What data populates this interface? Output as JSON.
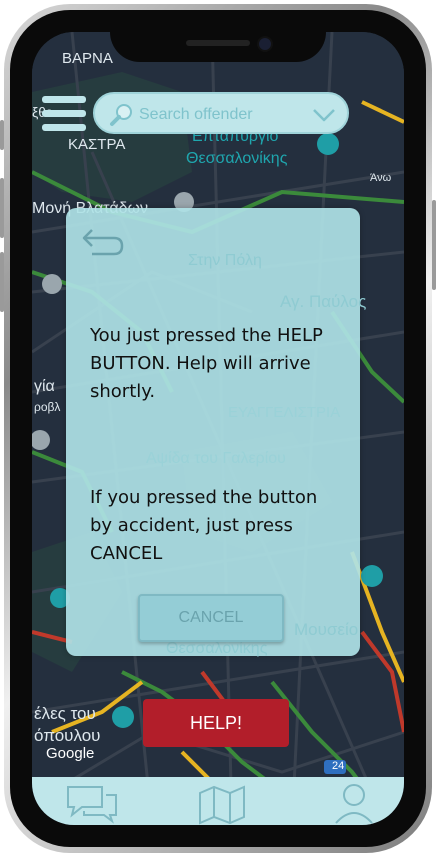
{
  "search": {
    "placeholder": "Search offender"
  },
  "map": {
    "labels": {
      "varna": "ΒΑΡΝΑ",
      "kastra": "ΚΑΣΤΡΑ",
      "eptapyrgio": "Επταπύργιο",
      "thessalonikis": "Θεσσαλονίκης",
      "ano_poli": "Άνω",
      "moni_vlatadon": "Μονή Βλατάδων",
      "stin_poli": "Στην Πόλη",
      "ag_pavlos": "Αγ. Παύλος",
      "gia": "γία",
      "rovli": "ροβλ",
      "evangelistria": "ΕΥΑΓΓΕΛΙΣΤΡΙΑ",
      "apsida": "Αψίδα του Γαλερίου",
      "mouseio": "Μουσείο",
      "thess2": "Θεσσαλονίκης",
      "vles": "έλες του",
      "opoulou": "όπουλου",
      "eo": "ξθε",
      "badge": "24"
    }
  },
  "dialog": {
    "message1": "You just pressed the HELP BUTTON. Help will arrive shortly.",
    "message2": "If you pressed the button by accident, just press CANCEL",
    "cancel_label": "CANCEL"
  },
  "help_label": "HELP!",
  "attribution": "Google",
  "colors": {
    "accent": "#bfe6ea",
    "dialog_bg": "#afe2e6",
    "help_red": "#b21e2a",
    "map_bg": "#242f3e"
  },
  "icons": {
    "menu": "hamburger-icon",
    "search": "magnifier-icon",
    "dropdown": "chevron-down-icon",
    "back": "back-arrow-icon",
    "chat": "chat-bubbles-icon",
    "map": "folded-map-icon",
    "profile": "user-icon"
  }
}
